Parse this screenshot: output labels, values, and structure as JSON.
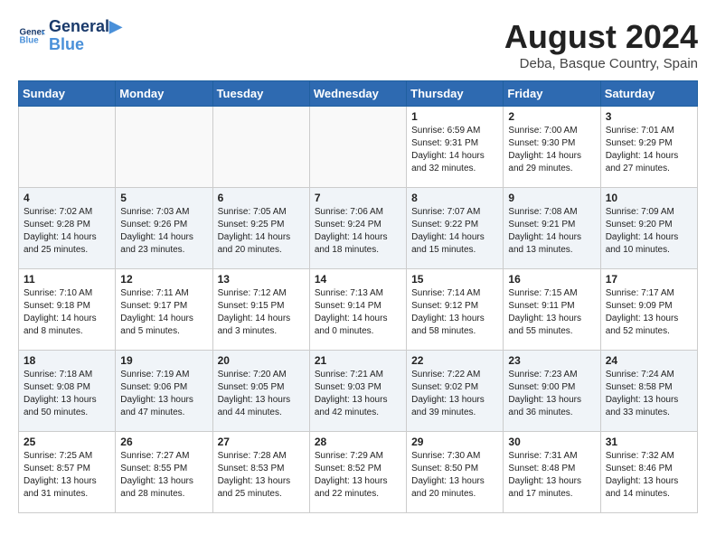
{
  "header": {
    "logo_line1": "General",
    "logo_line2": "Blue",
    "month_year": "August 2024",
    "location": "Deba, Basque Country, Spain"
  },
  "weekdays": [
    "Sunday",
    "Monday",
    "Tuesday",
    "Wednesday",
    "Thursday",
    "Friday",
    "Saturday"
  ],
  "weeks": [
    [
      {
        "day": "",
        "empty": true
      },
      {
        "day": "",
        "empty": true
      },
      {
        "day": "",
        "empty": true
      },
      {
        "day": "",
        "empty": true
      },
      {
        "day": "1",
        "sunrise": "6:59 AM",
        "sunset": "9:31 PM",
        "daylight": "14 hours and 32 minutes."
      },
      {
        "day": "2",
        "sunrise": "7:00 AM",
        "sunset": "9:30 PM",
        "daylight": "14 hours and 29 minutes."
      },
      {
        "day": "3",
        "sunrise": "7:01 AM",
        "sunset": "9:29 PM",
        "daylight": "14 hours and 27 minutes."
      }
    ],
    [
      {
        "day": "4",
        "sunrise": "7:02 AM",
        "sunset": "9:28 PM",
        "daylight": "14 hours and 25 minutes."
      },
      {
        "day": "5",
        "sunrise": "7:03 AM",
        "sunset": "9:26 PM",
        "daylight": "14 hours and 23 minutes."
      },
      {
        "day": "6",
        "sunrise": "7:05 AM",
        "sunset": "9:25 PM",
        "daylight": "14 hours and 20 minutes."
      },
      {
        "day": "7",
        "sunrise": "7:06 AM",
        "sunset": "9:24 PM",
        "daylight": "14 hours and 18 minutes."
      },
      {
        "day": "8",
        "sunrise": "7:07 AM",
        "sunset": "9:22 PM",
        "daylight": "14 hours and 15 minutes."
      },
      {
        "day": "9",
        "sunrise": "7:08 AM",
        "sunset": "9:21 PM",
        "daylight": "14 hours and 13 minutes."
      },
      {
        "day": "10",
        "sunrise": "7:09 AM",
        "sunset": "9:20 PM",
        "daylight": "14 hours and 10 minutes."
      }
    ],
    [
      {
        "day": "11",
        "sunrise": "7:10 AM",
        "sunset": "9:18 PM",
        "daylight": "14 hours and 8 minutes."
      },
      {
        "day": "12",
        "sunrise": "7:11 AM",
        "sunset": "9:17 PM",
        "daylight": "14 hours and 5 minutes."
      },
      {
        "day": "13",
        "sunrise": "7:12 AM",
        "sunset": "9:15 PM",
        "daylight": "14 hours and 3 minutes."
      },
      {
        "day": "14",
        "sunrise": "7:13 AM",
        "sunset": "9:14 PM",
        "daylight": "14 hours and 0 minutes."
      },
      {
        "day": "15",
        "sunrise": "7:14 AM",
        "sunset": "9:12 PM",
        "daylight": "13 hours and 58 minutes."
      },
      {
        "day": "16",
        "sunrise": "7:15 AM",
        "sunset": "9:11 PM",
        "daylight": "13 hours and 55 minutes."
      },
      {
        "day": "17",
        "sunrise": "7:17 AM",
        "sunset": "9:09 PM",
        "daylight": "13 hours and 52 minutes."
      }
    ],
    [
      {
        "day": "18",
        "sunrise": "7:18 AM",
        "sunset": "9:08 PM",
        "daylight": "13 hours and 50 minutes."
      },
      {
        "day": "19",
        "sunrise": "7:19 AM",
        "sunset": "9:06 PM",
        "daylight": "13 hours and 47 minutes."
      },
      {
        "day": "20",
        "sunrise": "7:20 AM",
        "sunset": "9:05 PM",
        "daylight": "13 hours and 44 minutes."
      },
      {
        "day": "21",
        "sunrise": "7:21 AM",
        "sunset": "9:03 PM",
        "daylight": "13 hours and 42 minutes."
      },
      {
        "day": "22",
        "sunrise": "7:22 AM",
        "sunset": "9:02 PM",
        "daylight": "13 hours and 39 minutes."
      },
      {
        "day": "23",
        "sunrise": "7:23 AM",
        "sunset": "9:00 PM",
        "daylight": "13 hours and 36 minutes."
      },
      {
        "day": "24",
        "sunrise": "7:24 AM",
        "sunset": "8:58 PM",
        "daylight": "13 hours and 33 minutes."
      }
    ],
    [
      {
        "day": "25",
        "sunrise": "7:25 AM",
        "sunset": "8:57 PM",
        "daylight": "13 hours and 31 minutes."
      },
      {
        "day": "26",
        "sunrise": "7:27 AM",
        "sunset": "8:55 PM",
        "daylight": "13 hours and 28 minutes."
      },
      {
        "day": "27",
        "sunrise": "7:28 AM",
        "sunset": "8:53 PM",
        "daylight": "13 hours and 25 minutes."
      },
      {
        "day": "28",
        "sunrise": "7:29 AM",
        "sunset": "8:52 PM",
        "daylight": "13 hours and 22 minutes."
      },
      {
        "day": "29",
        "sunrise": "7:30 AM",
        "sunset": "8:50 PM",
        "daylight": "13 hours and 20 minutes."
      },
      {
        "day": "30",
        "sunrise": "7:31 AM",
        "sunset": "8:48 PM",
        "daylight": "13 hours and 17 minutes."
      },
      {
        "day": "31",
        "sunrise": "7:32 AM",
        "sunset": "8:46 PM",
        "daylight": "13 hours and 14 minutes."
      }
    ]
  ]
}
